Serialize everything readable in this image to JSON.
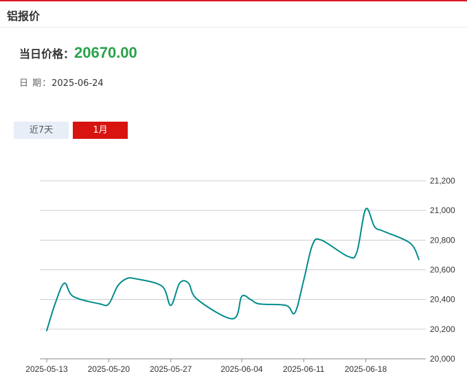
{
  "header": {
    "title": "铝报价"
  },
  "price": {
    "label": "当日价格：",
    "value": "20670.00"
  },
  "date": {
    "label": "日 期：",
    "value": "2025-06-24"
  },
  "tabs": [
    {
      "label": "近7天",
      "active": false
    },
    {
      "label": "1月",
      "active": true
    }
  ],
  "colors": {
    "accent": "#d7140f",
    "price": "#2aa14a",
    "line": "#008b8b"
  },
  "chart_data": {
    "type": "line",
    "x": [
      "2025-05-13",
      "2025-05-14",
      "2025-05-15",
      "2025-05-16",
      "2025-05-19",
      "2025-05-20",
      "2025-05-21",
      "2025-05-22",
      "2025-05-23",
      "2025-05-26",
      "2025-05-27",
      "2025-05-28",
      "2025-05-29",
      "2025-05-30",
      "2025-06-03",
      "2025-06-04",
      "2025-06-05",
      "2025-06-06",
      "2025-06-09",
      "2025-06-10",
      "2025-06-11",
      "2025-06-12",
      "2025-06-13",
      "2025-06-16",
      "2025-06-17",
      "2025-06-18",
      "2025-06-19",
      "2025-06-20",
      "2025-06-23",
      "2025-06-24"
    ],
    "values": [
      20190,
      20380,
      20510,
      20420,
      20370,
      20370,
      20490,
      20540,
      20540,
      20490,
      20360,
      20510,
      20510,
      20400,
      20270,
      20420,
      20400,
      20370,
      20360,
      20310,
      20530,
      20770,
      20800,
      20690,
      20720,
      21010,
      20890,
      20860,
      20780,
      20670
    ],
    "x_ticks": [
      "2025-05-13",
      "2025-05-20",
      "2025-05-27",
      "2025-06-04",
      "2025-06-11",
      "2025-06-18"
    ],
    "y_ticks": [
      "20,000",
      "20,200",
      "20,400",
      "20,600",
      "20,800",
      "21,000",
      "21,200"
    ],
    "ylim": [
      20000,
      21200
    ],
    "grid": true,
    "y_axis_position": "right",
    "line_color": "#008b8b"
  }
}
